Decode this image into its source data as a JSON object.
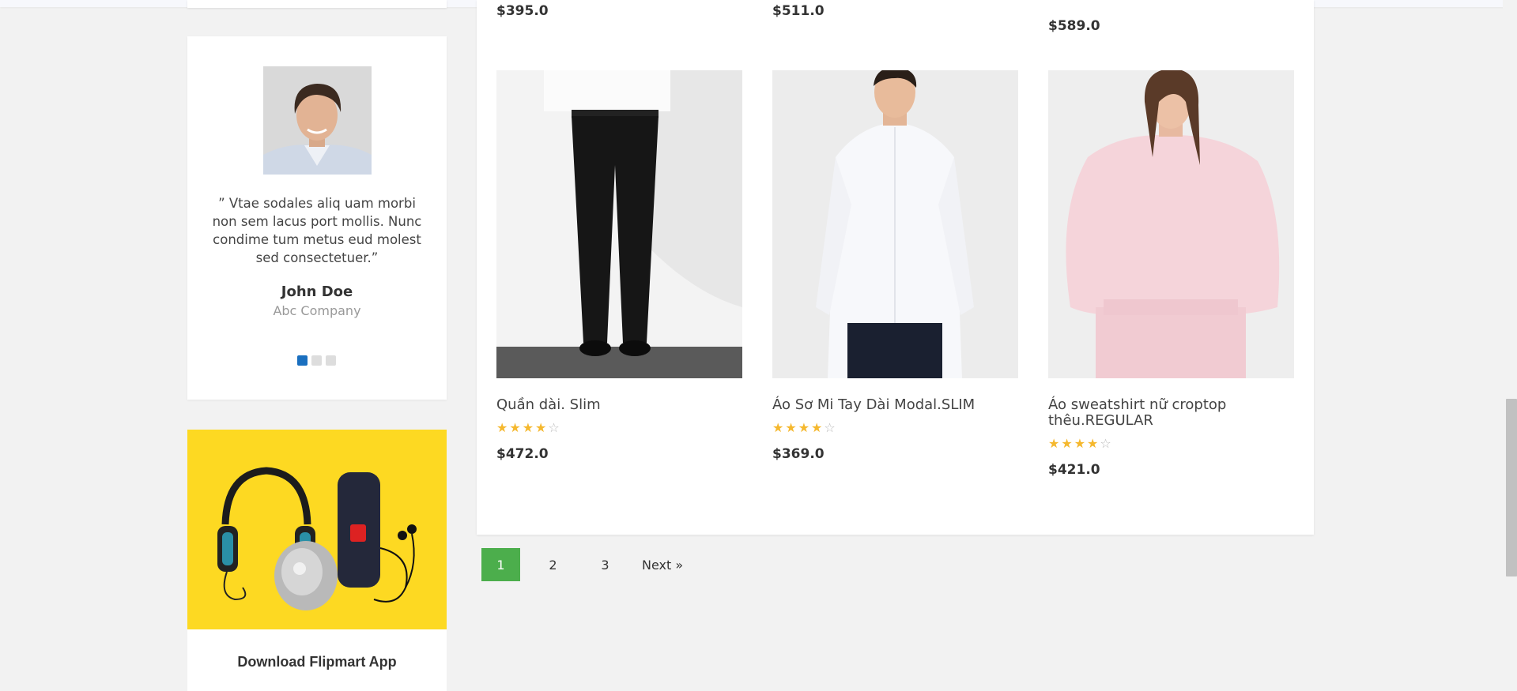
{
  "testimonial": {
    "quote": "” Vtae sodales aliq uam morbi non sem lacus port mollis. Nunc condime tum metus eud molest sed consectetuer.”",
    "name": "John Doe",
    "company": "Abc Company",
    "slides": 3,
    "active_slide": 1
  },
  "app_banner": {
    "title": "Download Flipmart App"
  },
  "previous_row_prices": [
    "$395.0",
    "$511.0",
    "$589.0"
  ],
  "products": [
    {
      "name": "Quần dài. Slim",
      "rating": 4,
      "max_rating": 5,
      "price": "$472.0"
    },
    {
      "name": "Áo Sơ Mi Tay Dài Modal.SLIM",
      "rating": 4,
      "max_rating": 5,
      "price": "$369.0"
    },
    {
      "name": "Áo sweatshirt nữ croptop thêu.REGULAR",
      "rating": 4,
      "max_rating": 5,
      "price": "$421.0"
    }
  ],
  "pagination": {
    "pages": [
      "1",
      "2",
      "3"
    ],
    "active": "1",
    "next_label": "Next »"
  },
  "colors": {
    "page_bg": "#f2f2f2",
    "active_page": "#4cae4c",
    "active_dot": "#1a6fbf",
    "banner_yellow": "#fdd922",
    "star": "#f5b82e"
  }
}
